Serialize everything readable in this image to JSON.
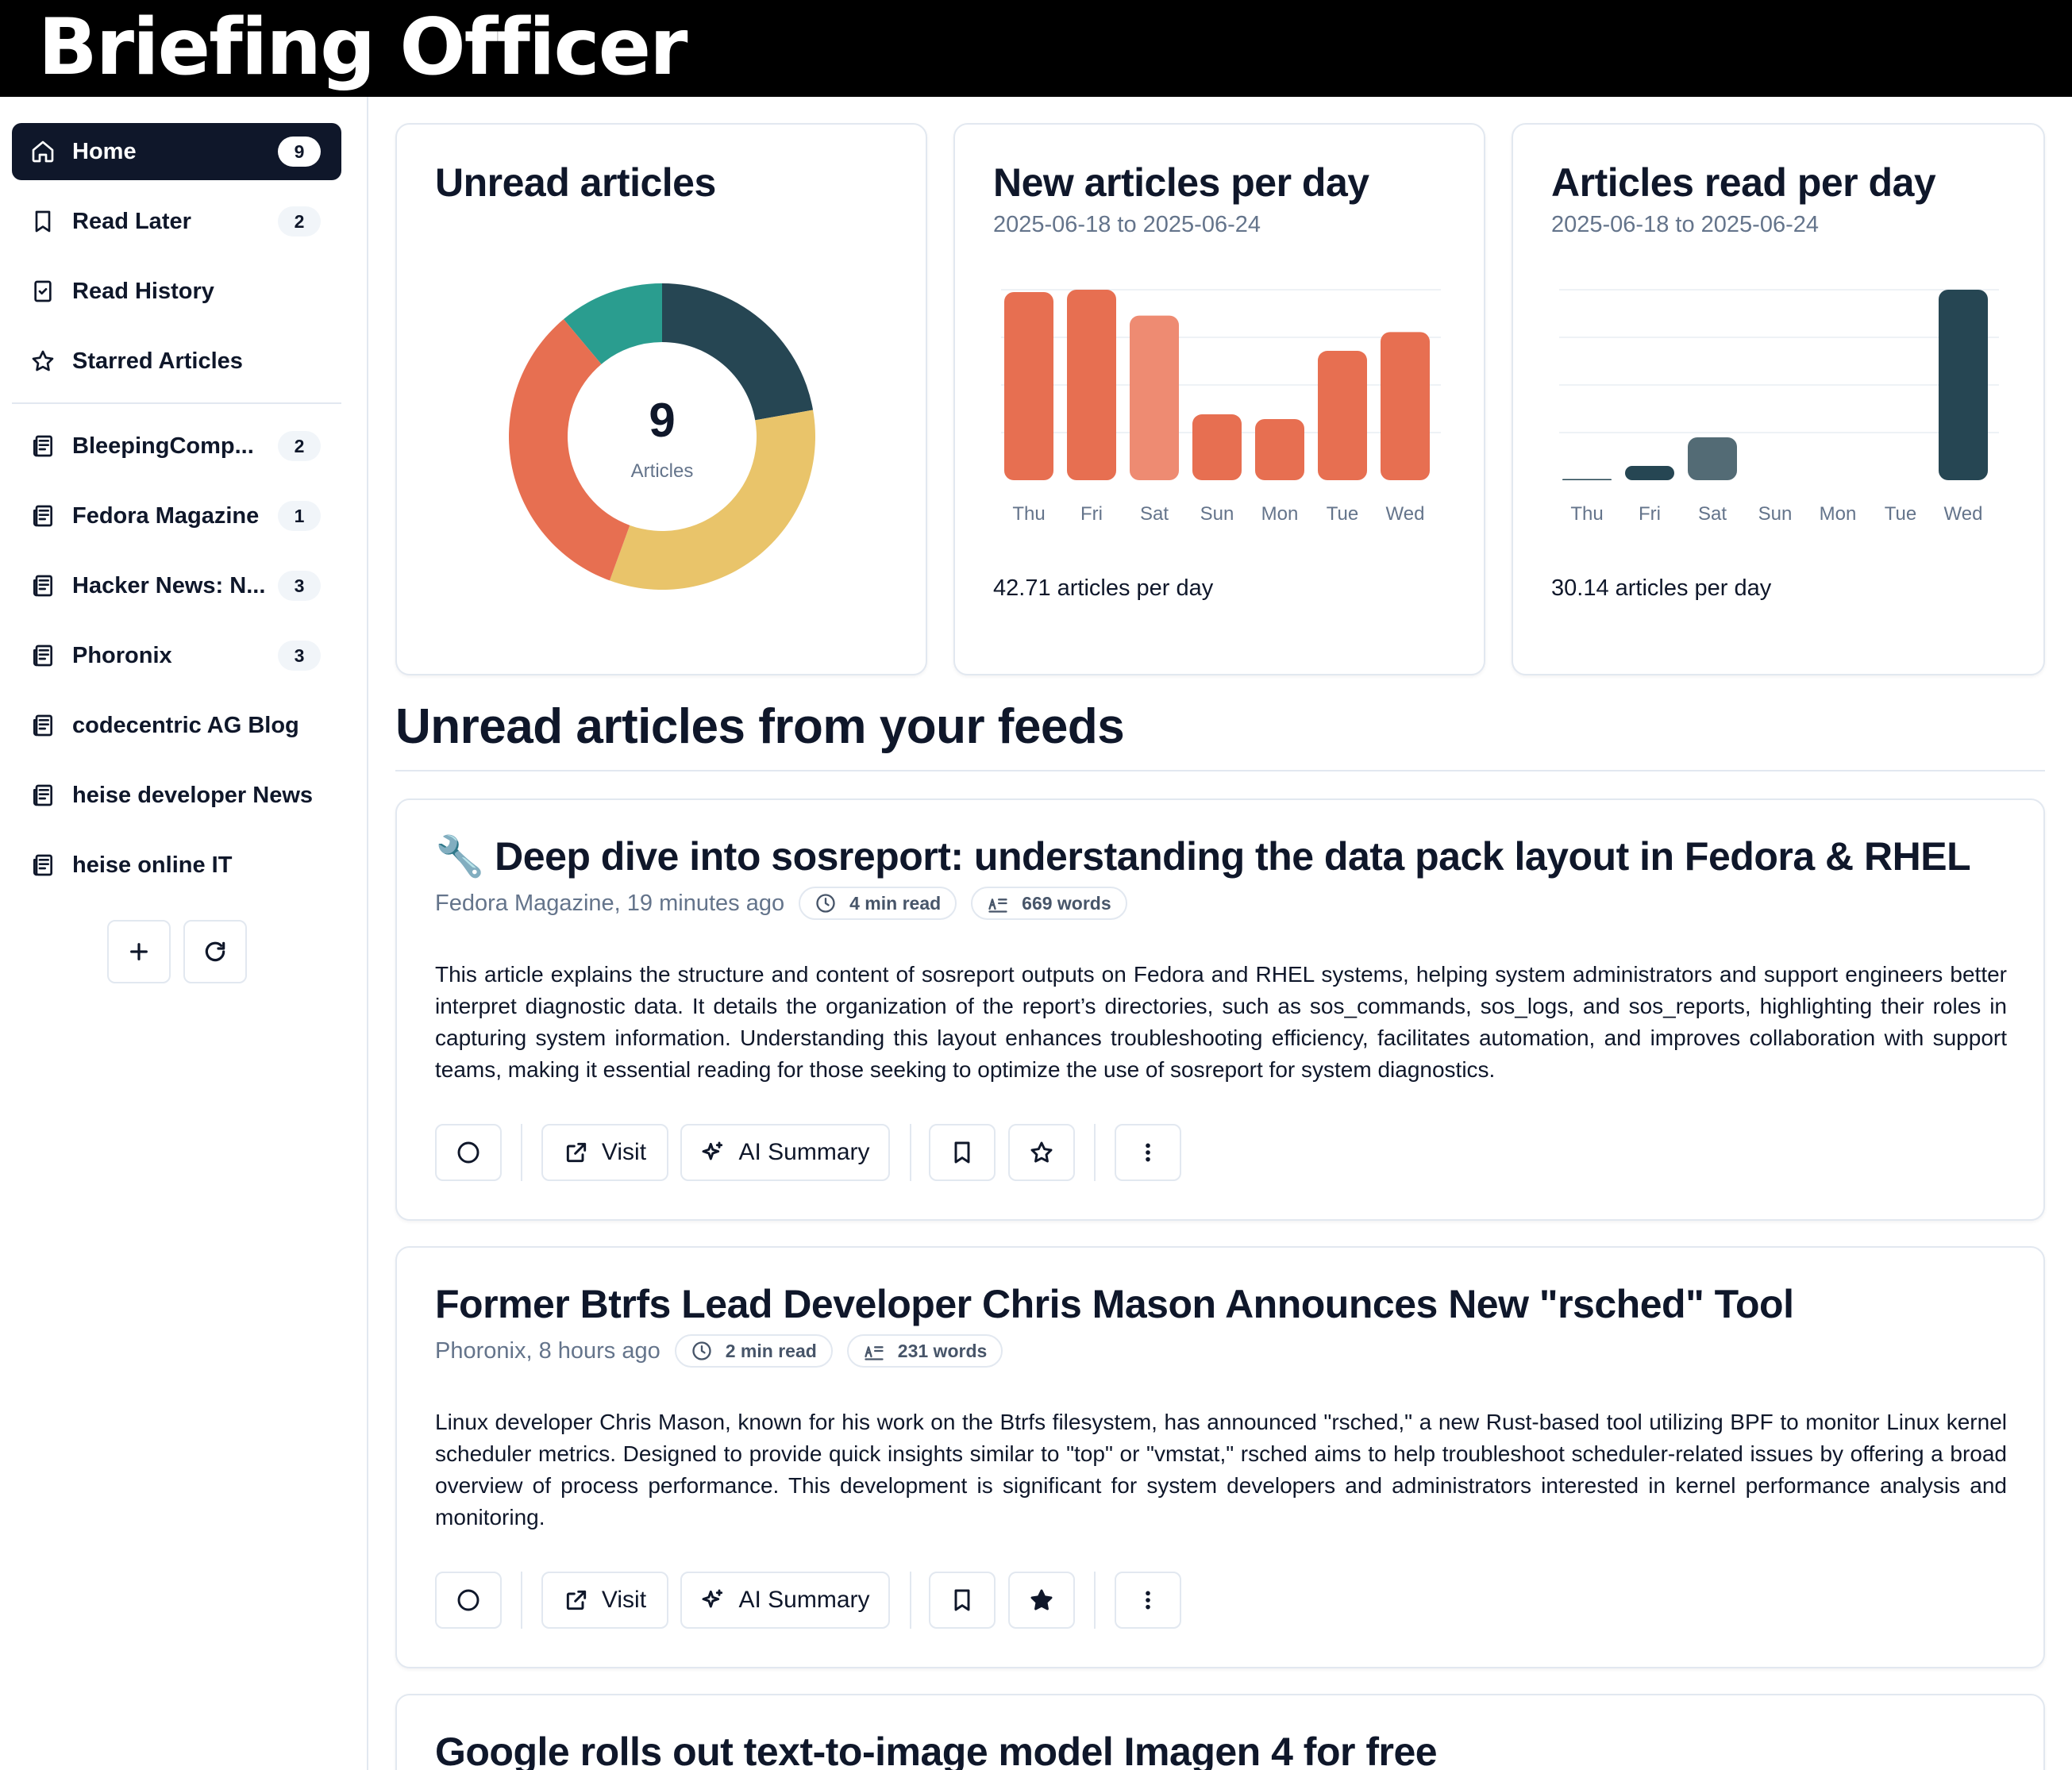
{
  "app": {
    "title": "Briefing Officer"
  },
  "sidebar": {
    "nav": [
      {
        "label": "Home",
        "count": "9",
        "icon": "home-icon",
        "active": true
      },
      {
        "label": "Read Later",
        "count": "2",
        "icon": "bookmark-icon"
      },
      {
        "label": "Read History",
        "icon": "history-check-icon"
      },
      {
        "label": "Starred Articles",
        "icon": "star-icon"
      }
    ],
    "feeds": [
      {
        "label": "BleepingComp...",
        "count": "2",
        "icon": "newspaper-icon"
      },
      {
        "label": "Fedora Magazine",
        "count": "1",
        "icon": "newspaper-icon"
      },
      {
        "label": "Hacker News: N...",
        "count": "3",
        "icon": "newspaper-icon"
      },
      {
        "label": "Phoronix",
        "count": "3",
        "icon": "newspaper-icon"
      },
      {
        "label": "codecentric AG Blog",
        "icon": "newspaper-icon"
      },
      {
        "label": "heise developer News",
        "icon": "newspaper-icon"
      },
      {
        "label": "heise online IT",
        "icon": "newspaper-icon"
      }
    ],
    "buttons": {
      "add_icon": "plus-icon",
      "refresh_icon": "refresh-icon"
    }
  },
  "stats": {
    "unread": {
      "title": "Unread articles",
      "total": "9",
      "total_label": "Articles"
    },
    "new_per_day": {
      "title": "New articles per day",
      "range": "2025-06-18 to 2025-06-24",
      "footer": "42.71 articles per day"
    },
    "read_per_day": {
      "title": "Articles read per day",
      "range": "2025-06-18 to 2025-06-24",
      "footer": "30.14 articles per day"
    }
  },
  "chart_data": [
    {
      "type": "pie",
      "categories": [
        "Fedora Magazine",
        "BleepingComp...",
        "Hacker News: N...",
        "Phoronix"
      ],
      "values": [
        1,
        2,
        3,
        3
      ],
      "colors": [
        "#2a9d8f",
        "#264653",
        "#e9c46a",
        "#e76f51"
      ],
      "center_value": "9",
      "center_label": "Articles"
    },
    {
      "type": "bar",
      "categories": [
        "Thu",
        "Fri",
        "Sat",
        "Sun",
        "Mon",
        "Tue",
        "Wed"
      ],
      "values": [
        80,
        81,
        70,
        28,
        26,
        55,
        63
      ],
      "highlight_index": 2,
      "color": "#e76f51",
      "highlight_color": "#ee8b72",
      "ylim": [
        0,
        81
      ],
      "grid": true
    },
    {
      "type": "bar",
      "categories": [
        "Thu",
        "Fri",
        "Sat",
        "Sun",
        "Mon",
        "Tue",
        "Wed"
      ],
      "values": [
        0.5,
        6,
        18,
        0,
        0,
        0,
        80
      ],
      "highlight_index": 2,
      "color": "#264653",
      "highlight_color": "#536b75",
      "ylim": [
        0,
        80
      ],
      "grid": true
    }
  ],
  "feed": {
    "heading": "Unread articles from your feeds",
    "action_labels": {
      "visit": "Visit",
      "ai_summary": "AI Summary"
    },
    "articles": [
      {
        "title": "🔧 Deep dive into sosreport: understanding the data pack layout in Fedora & RHEL",
        "source": "Fedora Magazine, 19 minutes ago",
        "read_time": "4 min read",
        "words": "669 words",
        "summary": "This article explains the structure and content of sosreport outputs on Fedora and RHEL systems, helping system administrators and support engineers better interpret diagnostic data. It details the organization of the report’s directories, such as sos_commands, sos_logs, and sos_reports, highlighting their roles in capturing system information. Understanding this layout enhances troubleshooting efficiency, facilitates automation, and improves collaboration with support teams, making it essential reading for those seeking to optimize the use of sosreport for system diagnostics.",
        "starred": false
      },
      {
        "title": "Former Btrfs Lead Developer Chris Mason Announces New \"rsched\" Tool",
        "source": "Phoronix, 8 hours ago",
        "read_time": "2 min read",
        "words": "231 words",
        "summary": "Linux developer Chris Mason, known for his work on the Btrfs filesystem, has announced \"rsched,\" a new Rust-based tool utilizing BPF to monitor Linux kernel scheduler metrics. Designed to provide quick insights similar to \"top\" or \"vmstat,\" rsched aims to help troubleshoot scheduler-related issues by offering a broad overview of process performance. This development is significant for system developers and administrators interested in kernel performance analysis and monitoring.",
        "starred": true
      },
      {
        "title": "Google rolls out text-to-image model Imagen 4 for free"
      }
    ]
  }
}
